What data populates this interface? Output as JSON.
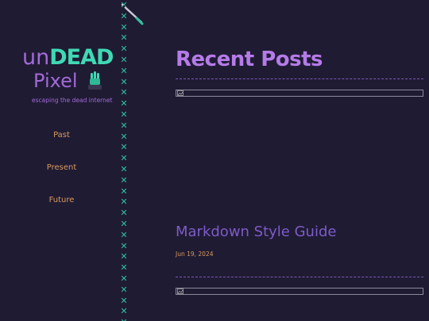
{
  "site": {
    "logo_un": "un",
    "logo_dead": "DEAD",
    "logo_pixel": "Pixel",
    "tagline": "escaping the dead internet"
  },
  "nav": {
    "items": [
      {
        "label": "Past"
      },
      {
        "label": "Present"
      },
      {
        "label": "Future"
      }
    ]
  },
  "main": {
    "title": "Recent Posts",
    "posts": [
      {
        "title": "Markdown Style Guide",
        "date": "Jun 19, 2024"
      }
    ]
  },
  "icons": {
    "logo_mascot": "zombie-hand-icon",
    "decoration": "needle-icon",
    "missing_image": "broken-image-icon",
    "border": "cross-stitch"
  },
  "colors": {
    "background": "#1f1b33",
    "accent_purple": "#b57be8",
    "accent_teal": "#3fd9b4",
    "nav_orange": "#d89a5e"
  }
}
